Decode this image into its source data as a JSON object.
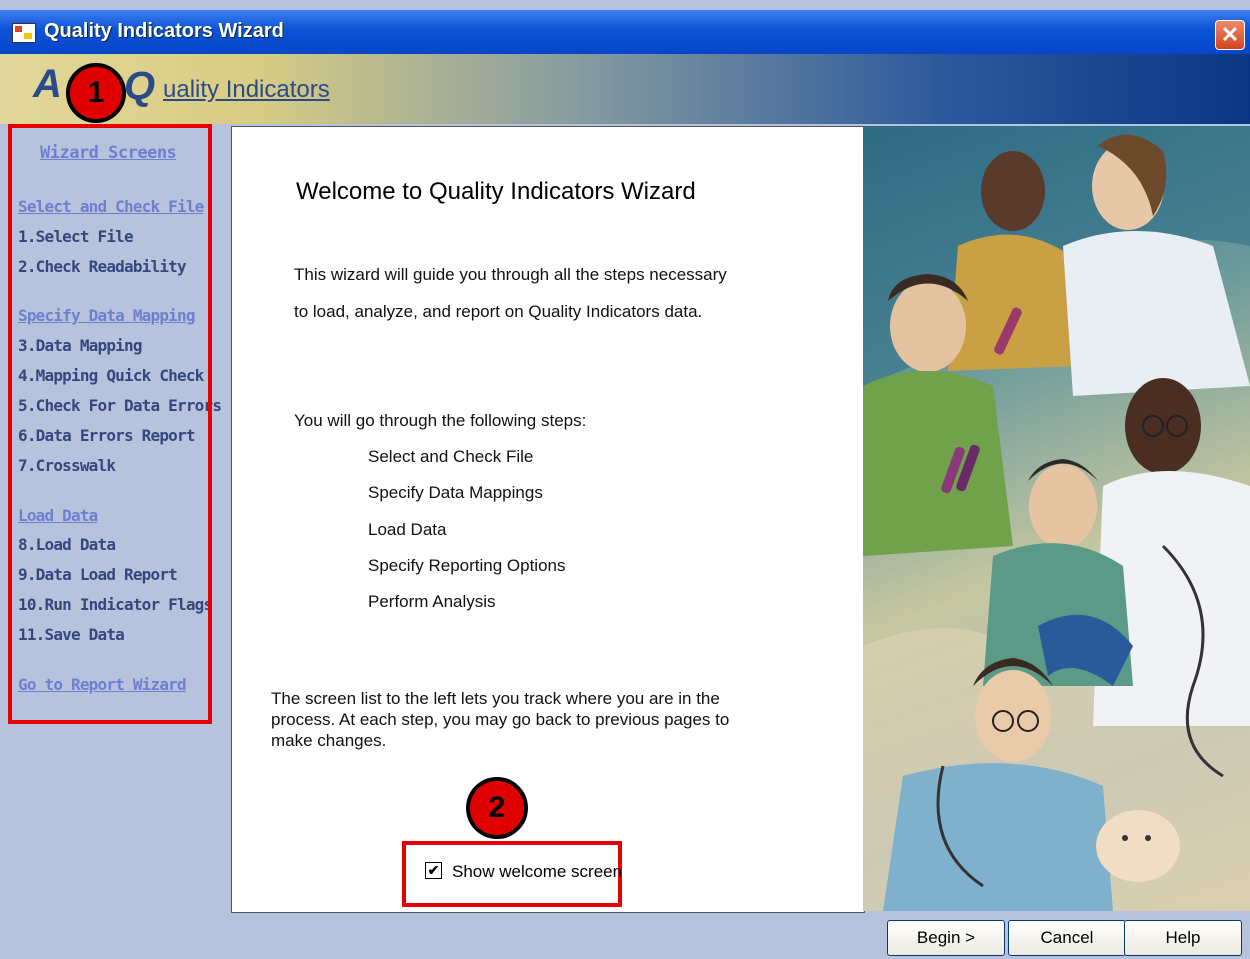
{
  "window": {
    "title": "Quality Indicators Wizard",
    "close_glyph": "✕"
  },
  "banner": {
    "logo_a": "A",
    "logo_q": "Q",
    "logo_text": "uality Indicators"
  },
  "callouts": [
    "1",
    "2"
  ],
  "sidebar": {
    "heading": "Wizard Screens",
    "groups": [
      {
        "label": "Select and Check File",
        "items": [
          "1.Select File",
          "2.Check Readability"
        ]
      },
      {
        "label": "Specify Data Mapping",
        "items": [
          "3.Data Mapping",
          "4.Mapping Quick Check",
          "5.Check For Data Errors",
          "6.Data Errors Report",
          "7.Crosswalk"
        ]
      },
      {
        "label": "Load Data",
        "items": [
          "8.Load Data",
          "9.Data Load Report",
          "10.Run Indicator Flags",
          "11.Save Data"
        ]
      }
    ],
    "report_link": "Go to Report Wizard"
  },
  "content": {
    "title": "Welcome to Quality Indicators Wizard",
    "intro_1": "This wizard will guide you through all the steps necessary",
    "intro_2": "to load, analyze, and report on Quality Indicators data.",
    "steps_intro": "You will go through the following steps:",
    "steps": [
      "Select and Check File",
      "Specify Data Mappings",
      "Load Data",
      "Specify Reporting Options",
      "Perform Analysis"
    ],
    "note_1": "The screen list to the left lets you track where you are in the",
    "note_2": "process.  At each step, you may go back to previous pages to",
    "note_3": "make changes.",
    "show_welcome": {
      "label": "Show welcome screen",
      "checked": true,
      "check_glyph": "✔"
    }
  },
  "buttons": {
    "begin": "Begin >",
    "cancel": "Cancel",
    "help": "Help"
  }
}
